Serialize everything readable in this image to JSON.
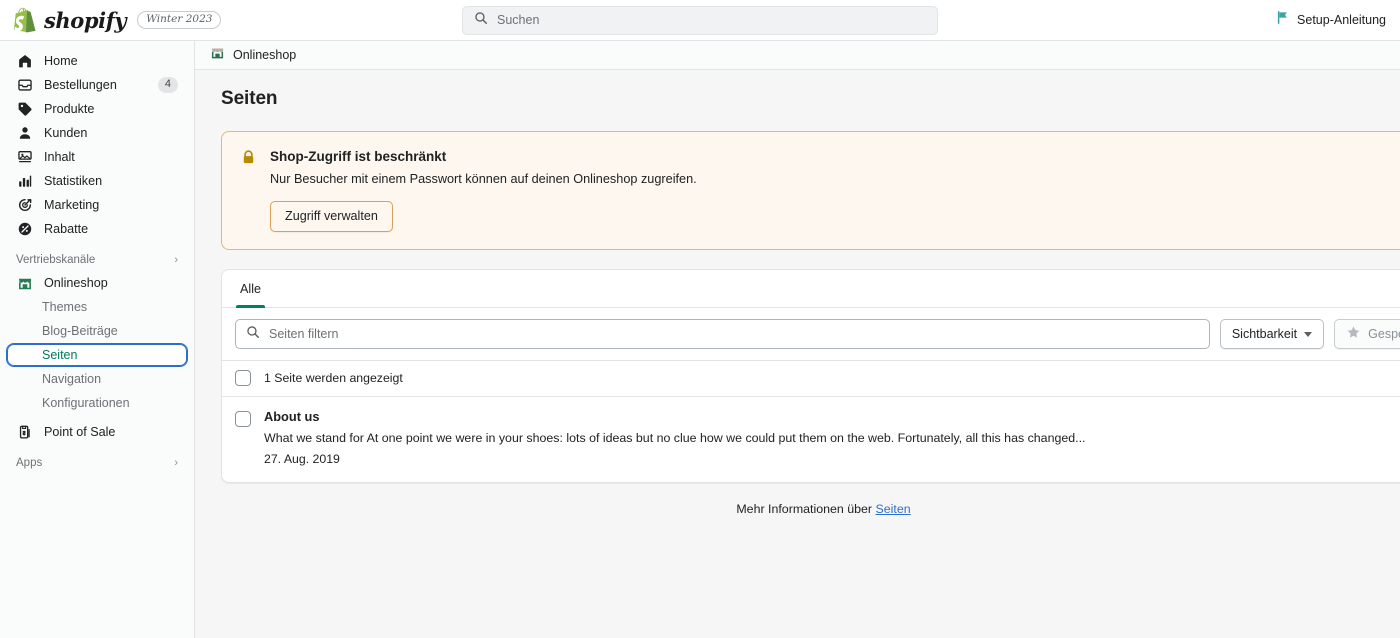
{
  "topbar": {
    "brand_name": "shopify",
    "version_badge": "Winter 2023",
    "search_placeholder": "Suchen",
    "setup_guide_label": "Setup-Anleitung"
  },
  "sidebar": {
    "main_items": [
      {
        "label": "Home",
        "icon": "home-icon",
        "badge": ""
      },
      {
        "label": "Bestellungen",
        "icon": "orders-icon",
        "badge": "4"
      },
      {
        "label": "Produkte",
        "icon": "products-tag-icon",
        "badge": ""
      },
      {
        "label": "Kunden",
        "icon": "customers-person-icon",
        "badge": ""
      },
      {
        "label": "Inhalt",
        "icon": "content-media-icon",
        "badge": ""
      },
      {
        "label": "Statistiken",
        "icon": "analytics-bars-icon",
        "badge": ""
      },
      {
        "label": "Marketing",
        "icon": "marketing-target-icon",
        "badge": ""
      },
      {
        "label": "Rabatte",
        "icon": "discounts-icon",
        "badge": ""
      }
    ],
    "channels_group_label": "Vertriebskanäle",
    "online_store_label": "Onlineshop",
    "online_store_children": [
      {
        "label": "Themes",
        "selected": false
      },
      {
        "label": "Blog-Beiträge",
        "selected": false
      },
      {
        "label": "Seiten",
        "selected": true
      },
      {
        "label": "Navigation",
        "selected": false
      },
      {
        "label": "Konfigurationen",
        "selected": false
      }
    ],
    "point_of_sale_label": "Point of Sale",
    "apps_group_label": "Apps"
  },
  "breadcrumb": {
    "label": "Onlineshop",
    "icon": "store-icon"
  },
  "page": {
    "title": "Seiten"
  },
  "banner": {
    "icon": "lock-icon",
    "title": "Shop-Zugriff ist beschränkt",
    "text": "Nur Besucher mit einem Passwort können auf deinen Onlineshop zugreifen.",
    "button_label": "Zugriff verwalten",
    "accent_color": "#e1b878",
    "background_color": "#fdf7f0"
  },
  "card": {
    "tabs": [
      {
        "label": "Alle",
        "active": true
      }
    ],
    "filter_placeholder": "Seiten filtern",
    "visibility_button_label": "Sichtbarkeit",
    "saved_button_label": "Gespeic",
    "select_all_text": "1 Seite werden angezeigt",
    "rows": [
      {
        "title": "About us",
        "excerpt": "What we stand for At one point we were in your shoes: lots of ideas but no clue how we could put them on the web. Fortunately, all this has changed...",
        "date": "27. Aug. 2019"
      }
    ]
  },
  "footer": {
    "text_prefix": "Mehr Informationen über ",
    "link_label": "Seiten"
  },
  "colors": {
    "brand_green": "#008060",
    "focus_blue": "#2c6ecb",
    "link_blue": "#2c6ecb",
    "warning_border": "#e1b878"
  }
}
